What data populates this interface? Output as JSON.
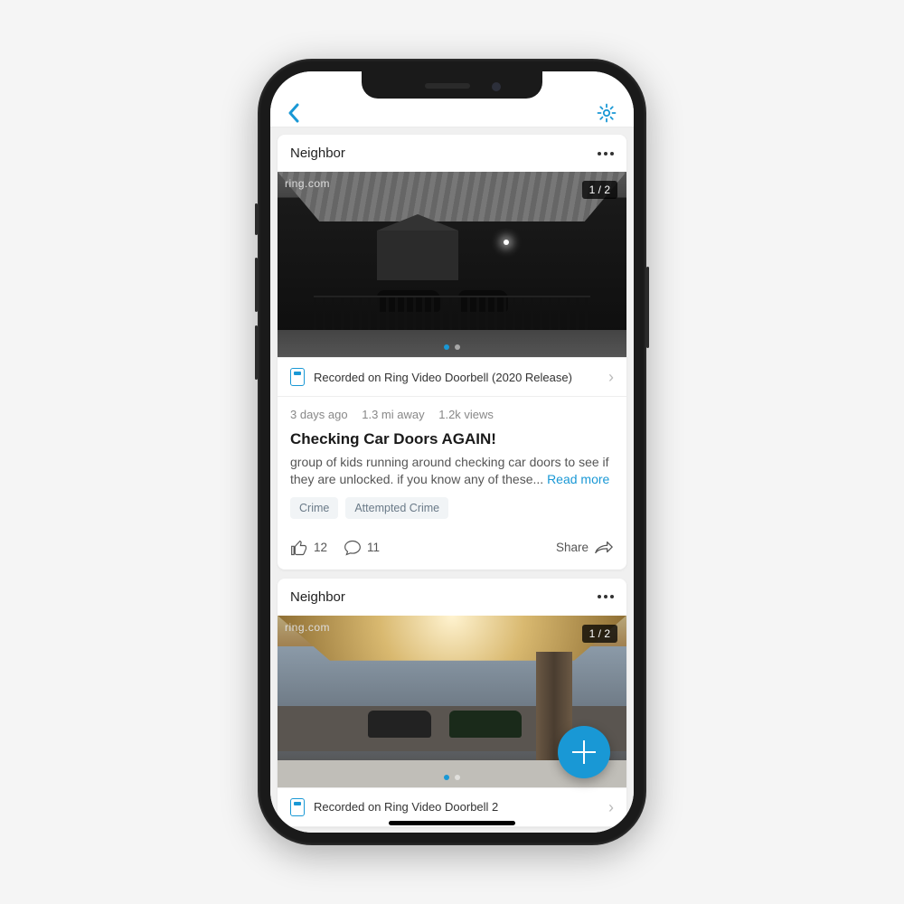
{
  "nav": {
    "back": "Back",
    "settings": "Settings"
  },
  "posts": [
    {
      "author": "Neighbor",
      "watermark": "ring.com",
      "media_counter": "1 / 2",
      "device_label": "Recorded on Ring Video Doorbell (2020 Release)",
      "time": "3 days ago",
      "distance": "1.3 mi away",
      "views": "1.2k views",
      "title": "Checking Car Doors AGAIN!",
      "body": "group of kids running around checking car doors to see if they are unlocked. if you know any of these... ",
      "read_more": "Read more",
      "tags": [
        "Crime",
        "Attempted Crime"
      ],
      "likes": "12",
      "comments": "11",
      "share": "Share"
    },
    {
      "author": "Neighbor",
      "watermark": "ring.com",
      "media_counter": "1 / 2",
      "device_label": "Recorded on Ring Video Doorbell 2"
    }
  ],
  "colors": {
    "accent": "#1998d5"
  }
}
